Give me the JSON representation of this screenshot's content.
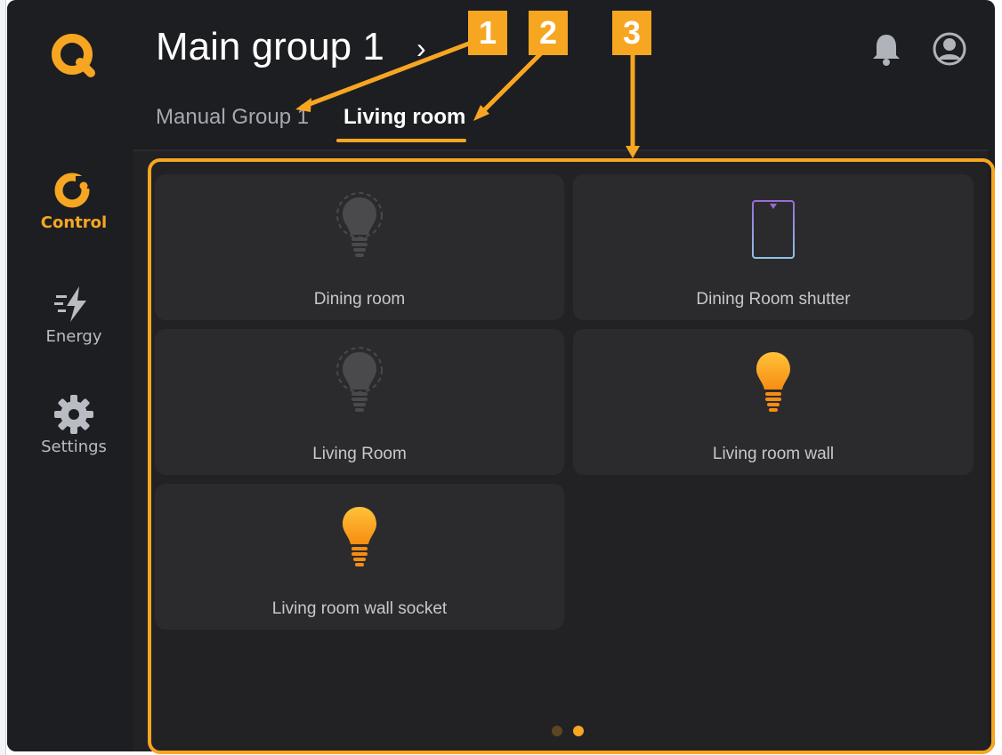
{
  "app": {
    "title": "Main group 1",
    "title_chevron": "›"
  },
  "sidebar": {
    "logo": "q-logo-icon",
    "items": [
      {
        "label": "Control",
        "icon": "control-icon",
        "active": true
      },
      {
        "label": "Energy",
        "icon": "energy-icon",
        "active": false
      },
      {
        "label": "Settings",
        "icon": "gear-icon",
        "active": false
      }
    ]
  },
  "header": {
    "icons": [
      "bell-icon",
      "account-icon"
    ],
    "tabs": [
      {
        "label": "Manual Group 1",
        "active": false
      },
      {
        "label": "Living room",
        "active": true
      }
    ]
  },
  "devices": [
    {
      "label": "Dining room",
      "icon": "bulb-icon",
      "state": "off"
    },
    {
      "label": "Dining Room shutter",
      "icon": "shutter-icon",
      "state": "n/a"
    },
    {
      "label": "Living Room",
      "icon": "bulb-icon",
      "state": "off"
    },
    {
      "label": "Living room wall",
      "icon": "bulb-icon",
      "state": "on"
    },
    {
      "label": "Living room wall socket",
      "icon": "bulb-icon",
      "state": "on"
    }
  ],
  "pager": {
    "pages": 2,
    "current": 2
  },
  "annotations": {
    "badges": [
      "1",
      "2",
      "3"
    ]
  },
  "colors": {
    "accent": "#f7a622",
    "background": "#1d1e22",
    "tile": "#2b2b2d",
    "bulb_off": "#4a4a4c"
  }
}
